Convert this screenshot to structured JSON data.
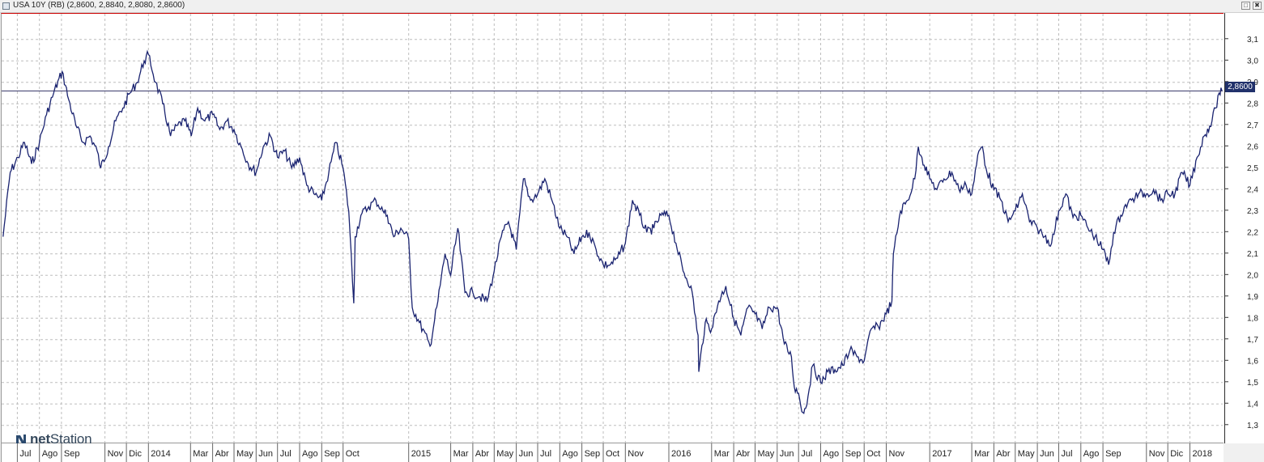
{
  "window": {
    "title": "USA 10Y (RB) (2,8600, 2,8840, 2,8080, 2,8600)",
    "buttons": {
      "restore": "□",
      "close": "✖"
    }
  },
  "logo": {
    "prefix": "net",
    "suffix": "Station"
  },
  "colors": {
    "series": "#1a2370",
    "grid": "#bdbdbd",
    "last_line": "#333366",
    "badge": "#21316b"
  },
  "last_value_label": "2,8600",
  "chart_data": {
    "type": "line",
    "title": "USA 10Y (RB)",
    "last": 2.86,
    "ylim": [
      1.22,
      3.22
    ],
    "ytick_values": [
      1.3,
      1.4,
      1.5,
      1.6,
      1.7,
      1.8,
      1.9,
      2.0,
      2.1,
      2.2,
      2.3,
      2.4,
      2.5,
      2.6,
      2.7,
      2.8,
      2.9,
      3.0,
      3.1
    ],
    "ytick_labels": [
      "1,3",
      "1,4",
      "1,5",
      "1,6",
      "1,7",
      "1,8",
      "1,9",
      "2,0",
      "2,1",
      "2,2",
      "2,3",
      "2,4",
      "2,5",
      "2,6",
      "2,7",
      "2,8",
      "2,9",
      "3,0",
      "3,1"
    ],
    "xlim": [
      "2013-06-08",
      "2018-02-15"
    ],
    "x_ticks": [
      {
        "date": "2013-06-30",
        "label": "Jul"
      },
      {
        "date": "2013-07-31",
        "label": "Ago"
      },
      {
        "date": "2013-08-31",
        "label": "Sep"
      },
      {
        "date": "2013-10-31",
        "label": "Nov"
      },
      {
        "date": "2013-11-30",
        "label": "Dic"
      },
      {
        "date": "2013-12-31",
        "label": "2014"
      },
      {
        "date": "2014-02-28",
        "label": "Mar"
      },
      {
        "date": "2014-03-31",
        "label": "Abr"
      },
      {
        "date": "2014-04-30",
        "label": "May"
      },
      {
        "date": "2014-05-31",
        "label": "Jun"
      },
      {
        "date": "2014-06-30",
        "label": "Jul"
      },
      {
        "date": "2014-07-31",
        "label": "Ago"
      },
      {
        "date": "2014-08-31",
        "label": "Sep"
      },
      {
        "date": "2014-09-30",
        "label": "Oct"
      },
      {
        "date": "2014-12-31",
        "label": "2015"
      },
      {
        "date": "2015-02-28",
        "label": "Mar"
      },
      {
        "date": "2015-03-31",
        "label": "Abr"
      },
      {
        "date": "2015-04-30",
        "label": "May"
      },
      {
        "date": "2015-05-31",
        "label": "Jun"
      },
      {
        "date": "2015-06-30",
        "label": "Jul"
      },
      {
        "date": "2015-07-31",
        "label": "Ago"
      },
      {
        "date": "2015-08-31",
        "label": "Sep"
      },
      {
        "date": "2015-09-30",
        "label": "Oct"
      },
      {
        "date": "2015-10-31",
        "label": "Nov"
      },
      {
        "date": "2015-12-31",
        "label": "2016"
      },
      {
        "date": "2016-02-29",
        "label": "Mar"
      },
      {
        "date": "2016-03-31",
        "label": "Abr"
      },
      {
        "date": "2016-04-30",
        "label": "May"
      },
      {
        "date": "2016-05-31",
        "label": "Jun"
      },
      {
        "date": "2016-06-30",
        "label": "Jul"
      },
      {
        "date": "2016-07-31",
        "label": "Ago"
      },
      {
        "date": "2016-08-31",
        "label": "Sep"
      },
      {
        "date": "2016-09-30",
        "label": "Oct"
      },
      {
        "date": "2016-10-31",
        "label": "Nov"
      },
      {
        "date": "2016-12-31",
        "label": "2017"
      },
      {
        "date": "2017-02-28",
        "label": "Mar"
      },
      {
        "date": "2017-03-31",
        "label": "Abr"
      },
      {
        "date": "2017-04-30",
        "label": "May"
      },
      {
        "date": "2017-05-31",
        "label": "Jun"
      },
      {
        "date": "2017-06-30",
        "label": "Jul"
      },
      {
        "date": "2017-07-31",
        "label": "Ago"
      },
      {
        "date": "2017-08-31",
        "label": "Sep"
      },
      {
        "date": "2017-10-31",
        "label": "Nov"
      },
      {
        "date": "2017-11-30",
        "label": "Dic"
      },
      {
        "date": "2017-12-31",
        "label": "2018"
      }
    ],
    "series": [
      {
        "values": [
          [
            "2013-06-10",
            2.18
          ],
          [
            "2013-06-20",
            2.48
          ],
          [
            "2013-07-01",
            2.55
          ],
          [
            "2013-07-10",
            2.62
          ],
          [
            "2013-07-20",
            2.52
          ],
          [
            "2013-07-31",
            2.62
          ],
          [
            "2013-08-10",
            2.75
          ],
          [
            "2013-08-20",
            2.85
          ],
          [
            "2013-09-01",
            2.95
          ],
          [
            "2013-09-10",
            2.82
          ],
          [
            "2013-09-20",
            2.7
          ],
          [
            "2013-09-30",
            2.62
          ],
          [
            "2013-10-10",
            2.65
          ],
          [
            "2013-10-20",
            2.58
          ],
          [
            "2013-10-25",
            2.5
          ],
          [
            "2013-11-05",
            2.6
          ],
          [
            "2013-11-15",
            2.72
          ],
          [
            "2013-11-25",
            2.78
          ],
          [
            "2013-12-05",
            2.85
          ],
          [
            "2013-12-15",
            2.9
          ],
          [
            "2013-12-25",
            3.0
          ],
          [
            "2013-12-31",
            3.03
          ],
          [
            "2014-01-10",
            2.9
          ],
          [
            "2014-01-20",
            2.8
          ],
          [
            "2014-01-31",
            2.65
          ],
          [
            "2014-02-10",
            2.7
          ],
          [
            "2014-02-20",
            2.72
          ],
          [
            "2014-03-01",
            2.65
          ],
          [
            "2014-03-10",
            2.78
          ],
          [
            "2014-03-20",
            2.72
          ],
          [
            "2014-03-31",
            2.75
          ],
          [
            "2014-04-10",
            2.68
          ],
          [
            "2014-04-20",
            2.72
          ],
          [
            "2014-04-30",
            2.68
          ],
          [
            "2014-05-10",
            2.6
          ],
          [
            "2014-05-20",
            2.52
          ],
          [
            "2014-05-31",
            2.48
          ],
          [
            "2014-06-10",
            2.6
          ],
          [
            "2014-06-20",
            2.65
          ],
          [
            "2014-06-30",
            2.55
          ],
          [
            "2014-07-10",
            2.58
          ],
          [
            "2014-07-20",
            2.5
          ],
          [
            "2014-07-31",
            2.55
          ],
          [
            "2014-08-10",
            2.42
          ],
          [
            "2014-08-20",
            2.38
          ],
          [
            "2014-08-31",
            2.35
          ],
          [
            "2014-09-10",
            2.48
          ],
          [
            "2014-09-20",
            2.62
          ],
          [
            "2014-09-30",
            2.5
          ],
          [
            "2014-10-08",
            2.3
          ],
          [
            "2014-10-15",
            1.87
          ],
          [
            "2014-10-17",
            2.18
          ],
          [
            "2014-10-25",
            2.28
          ],
          [
            "2014-11-05",
            2.32
          ],
          [
            "2014-11-15",
            2.35
          ],
          [
            "2014-11-25",
            2.3
          ],
          [
            "2014-12-01",
            2.28
          ],
          [
            "2014-12-10",
            2.18
          ],
          [
            "2014-12-20",
            2.22
          ],
          [
            "2014-12-31",
            2.17
          ],
          [
            "2015-01-05",
            1.85
          ],
          [
            "2015-01-15",
            1.78
          ],
          [
            "2015-01-30",
            1.67
          ],
          [
            "2015-02-10",
            1.88
          ],
          [
            "2015-02-20",
            2.1
          ],
          [
            "2015-02-28",
            2.0
          ],
          [
            "2015-03-10",
            2.22
          ],
          [
            "2015-03-20",
            1.92
          ],
          [
            "2015-03-31",
            1.92
          ],
          [
            "2015-04-10",
            1.9
          ],
          [
            "2015-04-20",
            1.88
          ],
          [
            "2015-04-30",
            2.02
          ],
          [
            "2015-05-10",
            2.18
          ],
          [
            "2015-05-20",
            2.25
          ],
          [
            "2015-05-31",
            2.12
          ],
          [
            "2015-06-10",
            2.45
          ],
          [
            "2015-06-20",
            2.35
          ],
          [
            "2015-06-30",
            2.38
          ],
          [
            "2015-07-10",
            2.45
          ],
          [
            "2015-07-20",
            2.35
          ],
          [
            "2015-07-31",
            2.22
          ],
          [
            "2015-08-10",
            2.18
          ],
          [
            "2015-08-20",
            2.1
          ],
          [
            "2015-08-31",
            2.18
          ],
          [
            "2015-09-10",
            2.2
          ],
          [
            "2015-09-20",
            2.12
          ],
          [
            "2015-09-30",
            2.05
          ],
          [
            "2015-10-10",
            2.05
          ],
          [
            "2015-10-20",
            2.08
          ],
          [
            "2015-10-31",
            2.15
          ],
          [
            "2015-11-10",
            2.35
          ],
          [
            "2015-11-20",
            2.28
          ],
          [
            "2015-11-30",
            2.2
          ],
          [
            "2015-12-10",
            2.22
          ],
          [
            "2015-12-20",
            2.28
          ],
          [
            "2015-12-31",
            2.28
          ],
          [
            "2016-01-10",
            2.15
          ],
          [
            "2016-01-20",
            2.02
          ],
          [
            "2016-01-31",
            1.95
          ],
          [
            "2016-02-10",
            1.72
          ],
          [
            "2016-02-11",
            1.55
          ],
          [
            "2016-02-20",
            1.78
          ],
          [
            "2016-02-29",
            1.75
          ],
          [
            "2016-03-10",
            1.88
          ],
          [
            "2016-03-20",
            1.95
          ],
          [
            "2016-03-31",
            1.8
          ],
          [
            "2016-04-10",
            1.72
          ],
          [
            "2016-04-20",
            1.85
          ],
          [
            "2016-04-30",
            1.82
          ],
          [
            "2016-05-10",
            1.75
          ],
          [
            "2016-05-20",
            1.85
          ],
          [
            "2016-05-31",
            1.85
          ],
          [
            "2016-06-10",
            1.68
          ],
          [
            "2016-06-20",
            1.62
          ],
          [
            "2016-06-24",
            1.48
          ],
          [
            "2016-06-30",
            1.45
          ],
          [
            "2016-07-06",
            1.36
          ],
          [
            "2016-07-10",
            1.38
          ],
          [
            "2016-07-20",
            1.58
          ],
          [
            "2016-07-31",
            1.5
          ],
          [
            "2016-08-10",
            1.55
          ],
          [
            "2016-08-20",
            1.56
          ],
          [
            "2016-08-31",
            1.58
          ],
          [
            "2016-09-10",
            1.65
          ],
          [
            "2016-09-20",
            1.62
          ],
          [
            "2016-09-30",
            1.6
          ],
          [
            "2016-10-10",
            1.75
          ],
          [
            "2016-10-20",
            1.76
          ],
          [
            "2016-10-31",
            1.82
          ],
          [
            "2016-11-08",
            1.88
          ],
          [
            "2016-11-10",
            2.1
          ],
          [
            "2016-11-20",
            2.3
          ],
          [
            "2016-11-30",
            2.35
          ],
          [
            "2016-12-10",
            2.45
          ],
          [
            "2016-12-15",
            2.6
          ],
          [
            "2016-12-20",
            2.55
          ],
          [
            "2016-12-31",
            2.45
          ],
          [
            "2017-01-10",
            2.4
          ],
          [
            "2017-01-20",
            2.45
          ],
          [
            "2017-01-31",
            2.48
          ],
          [
            "2017-02-10",
            2.4
          ],
          [
            "2017-02-20",
            2.42
          ],
          [
            "2017-02-28",
            2.38
          ],
          [
            "2017-03-10",
            2.58
          ],
          [
            "2017-03-15",
            2.6
          ],
          [
            "2017-03-20",
            2.5
          ],
          [
            "2017-03-31",
            2.4
          ],
          [
            "2017-04-10",
            2.35
          ],
          [
            "2017-04-20",
            2.25
          ],
          [
            "2017-04-30",
            2.3
          ],
          [
            "2017-05-10",
            2.38
          ],
          [
            "2017-05-20",
            2.25
          ],
          [
            "2017-05-31",
            2.22
          ],
          [
            "2017-06-10",
            2.18
          ],
          [
            "2017-06-20",
            2.15
          ],
          [
            "2017-06-30",
            2.3
          ],
          [
            "2017-07-10",
            2.38
          ],
          [
            "2017-07-20",
            2.27
          ],
          [
            "2017-07-31",
            2.28
          ],
          [
            "2017-08-10",
            2.22
          ],
          [
            "2017-08-20",
            2.18
          ],
          [
            "2017-08-31",
            2.12
          ],
          [
            "2017-09-08",
            2.05
          ],
          [
            "2017-09-15",
            2.2
          ],
          [
            "2017-09-25",
            2.28
          ],
          [
            "2017-09-30",
            2.32
          ],
          [
            "2017-10-10",
            2.35
          ],
          [
            "2017-10-20",
            2.38
          ],
          [
            "2017-10-31",
            2.38
          ],
          [
            "2017-11-10",
            2.4
          ],
          [
            "2017-11-20",
            2.35
          ],
          [
            "2017-11-30",
            2.38
          ],
          [
            "2017-12-10",
            2.38
          ],
          [
            "2017-12-20",
            2.48
          ],
          [
            "2017-12-31",
            2.42
          ],
          [
            "2018-01-10",
            2.55
          ],
          [
            "2018-01-20",
            2.65
          ],
          [
            "2018-01-31",
            2.72
          ],
          [
            "2018-02-05",
            2.78
          ],
          [
            "2018-02-10",
            2.85
          ],
          [
            "2018-02-14",
            2.86
          ]
        ]
      }
    ]
  }
}
